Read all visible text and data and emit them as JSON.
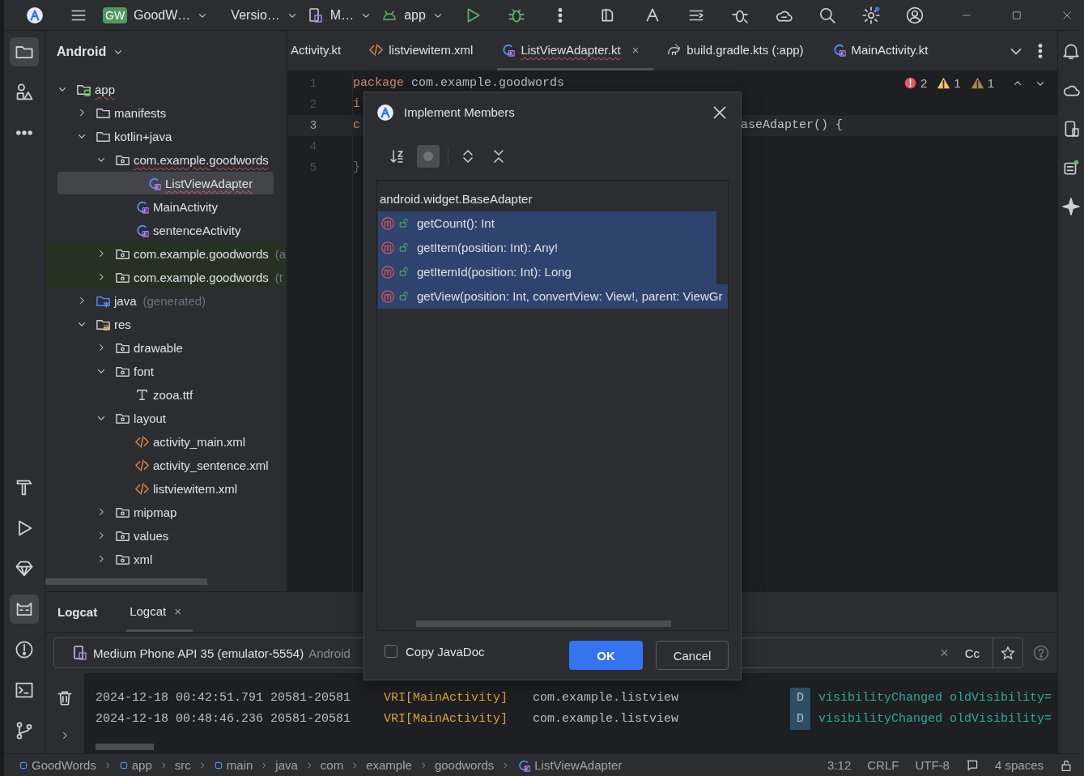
{
  "toolbar": {
    "project_badge": "GW",
    "project": "GoodW…",
    "vcs": "Versio…",
    "device": "M…",
    "run_config": "app"
  },
  "left_tools_top": [
    {
      "kind": "folder",
      "active": true
    },
    {
      "kind": "shapes",
      "active": false
    },
    {
      "kind": "more",
      "active": false
    }
  ],
  "left_tools_bottom": [
    {
      "kind": "hammer",
      "active": false
    },
    {
      "kind": "play",
      "active": false
    },
    {
      "kind": "gem",
      "active": false
    },
    {
      "kind": "cat",
      "active": true
    },
    {
      "kind": "alert",
      "active": false
    },
    {
      "kind": "terminal",
      "active": false
    },
    {
      "kind": "branch",
      "active": false
    }
  ],
  "right_tools": [
    {
      "kind": "bell"
    },
    {
      "kind": "cloud"
    },
    {
      "kind": "phone"
    },
    {
      "kind": "devices"
    },
    {
      "kind": "sparkle"
    }
  ],
  "project_panel": {
    "title": "Android",
    "tree": [
      {
        "label": "app",
        "kind": "module",
        "expanded": true,
        "selected": false,
        "has_error": true,
        "test_source": false,
        "children": [
          {
            "label": "manifests",
            "kind": "folder",
            "expanded": false,
            "selected": false,
            "has_error": false,
            "test_source": false
          },
          {
            "label": "kotlin+java",
            "kind": "folder",
            "expanded": true,
            "selected": false,
            "has_error": false,
            "test_source": false,
            "children": [
              {
                "label": "com.example.goodwords",
                "kind": "package",
                "expanded": true,
                "selected": false,
                "has_error": true,
                "test_source": false,
                "children": [
                  {
                    "label": "ListViewAdapter",
                    "kind": "class",
                    "selected": true,
                    "has_error": true,
                    "test_source": false
                  },
                  {
                    "label": "MainActivity",
                    "kind": "class",
                    "selected": false,
                    "has_error": false,
                    "test_source": false
                  },
                  {
                    "label": "sentenceActivity",
                    "kind": "class",
                    "selected": false,
                    "has_error": false,
                    "test_source": false
                  }
                ]
              },
              {
                "label": "com.example.goodwords",
                "hint": "(a",
                "kind": "package",
                "expanded": false,
                "selected": false,
                "has_error": false,
                "test_source": true
              },
              {
                "label": "com.example.goodwords",
                "hint": "(t",
                "kind": "package",
                "expanded": false,
                "selected": false,
                "has_error": false,
                "test_source": true
              }
            ]
          },
          {
            "label": "java",
            "hint": "(generated)",
            "kind": "generated",
            "expanded": false,
            "selected": false,
            "has_error": false,
            "test_source": false
          },
          {
            "label": "res",
            "kind": "res",
            "expanded": true,
            "selected": false,
            "has_error": false,
            "test_source": false,
            "children": [
              {
                "label": "drawable",
                "kind": "package",
                "expanded": false,
                "selected": false,
                "has_error": false,
                "test_source": false
              },
              {
                "label": "font",
                "kind": "package",
                "expanded": true,
                "selected": false,
                "has_error": false,
                "test_source": false,
                "children": [
                  {
                    "label": "zooa.ttf",
                    "kind": "font",
                    "selected": false,
                    "has_error": false,
                    "test_source": false
                  }
                ]
              },
              {
                "label": "layout",
                "kind": "package",
                "expanded": true,
                "selected": false,
                "has_error": false,
                "test_source": false,
                "children": [
                  {
                    "label": "activity_main.xml",
                    "kind": "xml",
                    "selected": false,
                    "has_error": false,
                    "test_source": false
                  },
                  {
                    "label": "activity_sentence.xml",
                    "kind": "xml",
                    "selected": false,
                    "has_error": false,
                    "test_source": false
                  },
                  {
                    "label": "listviewitem.xml",
                    "kind": "xml",
                    "selected": false,
                    "has_error": false,
                    "test_source": false
                  }
                ]
              },
              {
                "label": "mipmap",
                "kind": "package",
                "expanded": false,
                "selected": false,
                "has_error": false,
                "test_source": false
              },
              {
                "label": "values",
                "kind": "package",
                "expanded": false,
                "selected": false,
                "has_error": false,
                "test_source": false
              },
              {
                "label": "xml",
                "kind": "package",
                "expanded": false,
                "selected": false,
                "has_error": false,
                "test_source": false
              }
            ]
          }
        ]
      }
    ]
  },
  "editor_tabs": [
    {
      "label": "Activity.kt",
      "kind": "none",
      "selected": false,
      "has_error": false
    },
    {
      "label": "listviewitem.xml",
      "kind": "xml",
      "selected": false,
      "has_error": false
    },
    {
      "label": "ListViewAdapter.kt",
      "kind": "class",
      "selected": true,
      "has_error": true,
      "close": "×"
    },
    {
      "label": "build.gradle.kts (:app)",
      "kind": "gradle",
      "selected": false,
      "has_error": false
    },
    {
      "label": "MainActivity.kt",
      "kind": "class",
      "selected": false,
      "has_error": false
    }
  ],
  "code_lines": [
    {
      "number": "1",
      "current": false,
      "tokens": [
        {
          "text": "package",
          "kind": "keyword"
        },
        {
          "text": " com.example.goodwords",
          "kind": "plain"
        }
      ]
    },
    {
      "number": "2",
      "current": false,
      "tokens": [
        {
          "text": "i",
          "kind": "keyword"
        }
      ]
    },
    {
      "number": "3",
      "current": true,
      "tokens": [
        {
          "text": "c",
          "kind": "keyword"
        }
      ],
      "tail": "aseAdapter() {"
    },
    {
      "number": "4",
      "current": false
    },
    {
      "number": "5",
      "current": false,
      "tokens": [
        {
          "text": "}",
          "kind": "brace"
        }
      ]
    }
  ],
  "problems": [
    {
      "kind": "error",
      "count": "2"
    },
    {
      "kind": "warning",
      "count": "1"
    },
    {
      "kind": "weak_warning",
      "count": "1"
    }
  ],
  "dialog": {
    "title": "Implement Members",
    "tools": [
      {
        "kind": "sort",
        "on": false
      },
      {
        "kind": "circle",
        "on": true
      },
      {
        "kind": "expand",
        "on": false
      },
      {
        "kind": "collapse",
        "on": false
      }
    ],
    "root": "android.widget.BaseAdapter",
    "members": [
      {
        "signature": "getCount(): Int",
        "selected": true
      },
      {
        "signature": "getItem(position: Int): Any!",
        "selected": true
      },
      {
        "signature": "getItemId(position: Int): Long",
        "selected": true
      },
      {
        "signature": "getView(position: Int, convertView: View!, parent: ViewGr",
        "selected": true
      }
    ],
    "copy_javadoc": {
      "label": "Copy JavaDoc",
      "checked": false
    },
    "buttons": [
      {
        "label": "OK",
        "kind": "primary"
      },
      {
        "label": "Cancel",
        "kind": "secondary"
      }
    ]
  },
  "logcat": {
    "title": "Logcat",
    "tabs": [
      {
        "label": "Logcat",
        "close": "×",
        "selected": true
      }
    ],
    "filter": {
      "device": "Medium Phone API 35 (emulator-5554)",
      "device_suffix": "Android",
      "clear": "×",
      "case": "Cc"
    },
    "rows": [
      {
        "time": "2024-12-18 00:42:51.791 20581-20581",
        "tag": "VRI[MainActivity]",
        "package": "com.example.listview",
        "level": "D",
        "message": "visibilityChanged oldVisibility="
      },
      {
        "time": "2024-12-18 00:48:46.236 20581-20581",
        "tag": "VRI[MainActivity]",
        "package": "com.example.listview",
        "level": "D",
        "message": "visibilityChanged oldVisibility="
      }
    ]
  },
  "status_bar": {
    "breadcrumbs": [
      {
        "label": "GoodWords",
        "kind": "module"
      },
      {
        "label": "app",
        "kind": "module"
      },
      {
        "label": "src",
        "kind": "dir"
      },
      {
        "label": "main",
        "kind": "module"
      },
      {
        "label": "java",
        "kind": "dir"
      },
      {
        "label": "com",
        "kind": "dir"
      },
      {
        "label": "example",
        "kind": "dir"
      },
      {
        "label": "goodwords",
        "kind": "dir"
      },
      {
        "label": "ListViewAdapter",
        "kind": "class"
      }
    ],
    "position": "3:12",
    "line_separator": "CRLF",
    "encoding": "UTF-8",
    "indent": "4 spaces"
  }
}
